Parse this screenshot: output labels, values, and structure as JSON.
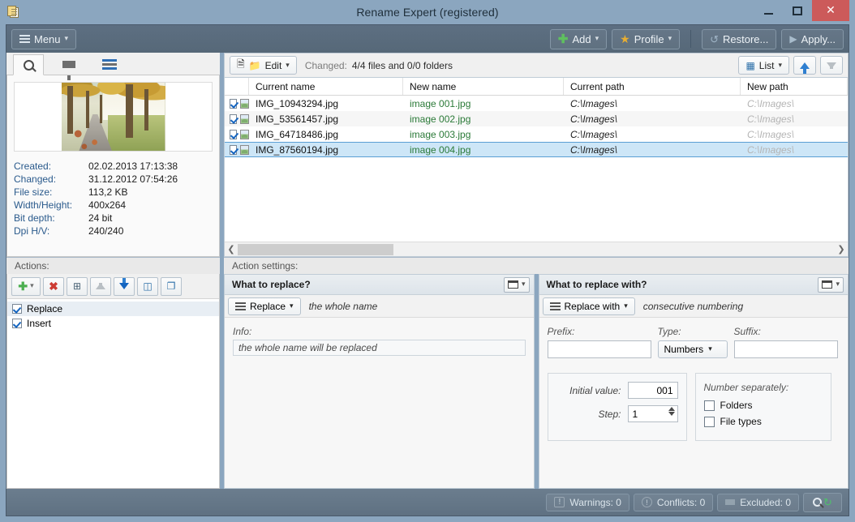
{
  "window": {
    "title": "Rename Expert (registered)",
    "app_icon": "clipboard-icon",
    "minimize": "–",
    "maximize": "□",
    "close": "✕"
  },
  "toolbar": {
    "menu_label": "Menu",
    "add_label": "Add",
    "profile_label": "Profile",
    "restore_label": "Restore...",
    "apply_label": "Apply..."
  },
  "sidebar": {
    "tabs": [
      {
        "name": "search-tab",
        "icon": "magnifier-icon"
      },
      {
        "name": "filter-tab",
        "icon": "funnel-icon"
      },
      {
        "name": "list-tab",
        "icon": "hamburger-icon"
      }
    ],
    "preview": {
      "image_alt": "autumn tree lined road",
      "metadata": [
        {
          "key": "Created:",
          "value": "02.02.2013 17:13:38"
        },
        {
          "key": "Changed:",
          "value": "31.12.2012 07:54:26"
        },
        {
          "key": "File size:",
          "value": "113,2 KB"
        },
        {
          "key": "Width/Height:",
          "value": "400x264"
        },
        {
          "key": "Bit depth:",
          "value": "24 bit"
        },
        {
          "key": "Dpi H/V:",
          "value": "240/240"
        }
      ]
    },
    "actions": {
      "label": "Actions:",
      "buttons": [
        {
          "name": "add-action-button",
          "icon": "plus-icon"
        },
        {
          "name": "remove-action-button",
          "icon": "red-x-icon"
        },
        {
          "name": "clear-actions-button",
          "icon": "list-delete-icon"
        },
        {
          "name": "move-up-button",
          "icon": "arrow-up-icon"
        },
        {
          "name": "move-down-button",
          "icon": "arrow-down-icon"
        },
        {
          "name": "rename-action-button",
          "icon": "rename-icon"
        },
        {
          "name": "duplicate-action-button",
          "icon": "copy-icon"
        }
      ],
      "items": [
        {
          "label": "Replace",
          "checked": true,
          "selected": true
        },
        {
          "label": "Insert",
          "checked": true,
          "selected": false
        }
      ]
    }
  },
  "filelist": {
    "edit_label": "Edit",
    "changed_label": "Changed:",
    "changed_value": "4/4 files and 0/0 folders",
    "view_label": "List",
    "columns": [
      "Current name",
      "New name",
      "Current path",
      "New path"
    ],
    "rows": [
      {
        "checked": true,
        "current_name": "IMG_10943294.jpg",
        "new_name": "image 001.jpg",
        "current_path": "C:\\Images\\",
        "new_path": "C:\\Images\\",
        "selected": false
      },
      {
        "checked": true,
        "current_name": "IMG_53561457.jpg",
        "new_name": "image 002.jpg",
        "current_path": "C:\\Images\\",
        "new_path": "C:\\Images\\",
        "selected": false
      },
      {
        "checked": true,
        "current_name": "IMG_64718486.jpg",
        "new_name": "image 003.jpg",
        "current_path": "C:\\Images\\",
        "new_path": "C:\\Images\\",
        "selected": false
      },
      {
        "checked": true,
        "current_name": "IMG_87560194.jpg",
        "new_name": "image 004.jpg",
        "current_path": "C:\\Images\\",
        "new_path": "C:\\Images\\",
        "selected": true
      }
    ]
  },
  "settings": {
    "label": "Action settings:",
    "what_to_replace": {
      "title": "What to replace?",
      "mode_label": "Replace",
      "mode_value": "the whole name",
      "info_label": "Info:",
      "info_text": "the whole name will be replaced"
    },
    "what_to_replace_with": {
      "title": "What to replace with?",
      "mode_label": "Replace with",
      "mode_value": "consecutive numbering",
      "prefix_label": "Prefix:",
      "prefix_value": "",
      "type_label": "Type:",
      "type_value": "Numbers",
      "suffix_label": "Suffix:",
      "suffix_value": "",
      "initial_value_label": "Initial value:",
      "initial_value": "001",
      "step_label": "Step:",
      "step_value": "1",
      "number_separately_label": "Number separately:",
      "folders_label": "Folders",
      "folders_checked": false,
      "file_types_label": "File types",
      "file_types_checked": false
    }
  },
  "statusbar": {
    "warnings": "Warnings: 0",
    "conflicts": "Conflicts: 0",
    "excluded": "Excluded: 0",
    "search_icon": "magnifier-icon",
    "refresh_icon": "refresh-icon"
  },
  "colors": {
    "title_bar": "#8ba6bf",
    "toolbar": "#5d6f82",
    "close_button": "#cc5a5a",
    "new_name_text": "#2b7a38",
    "selection": "#cde6f7",
    "accent_blue": "#2f7fd0"
  }
}
